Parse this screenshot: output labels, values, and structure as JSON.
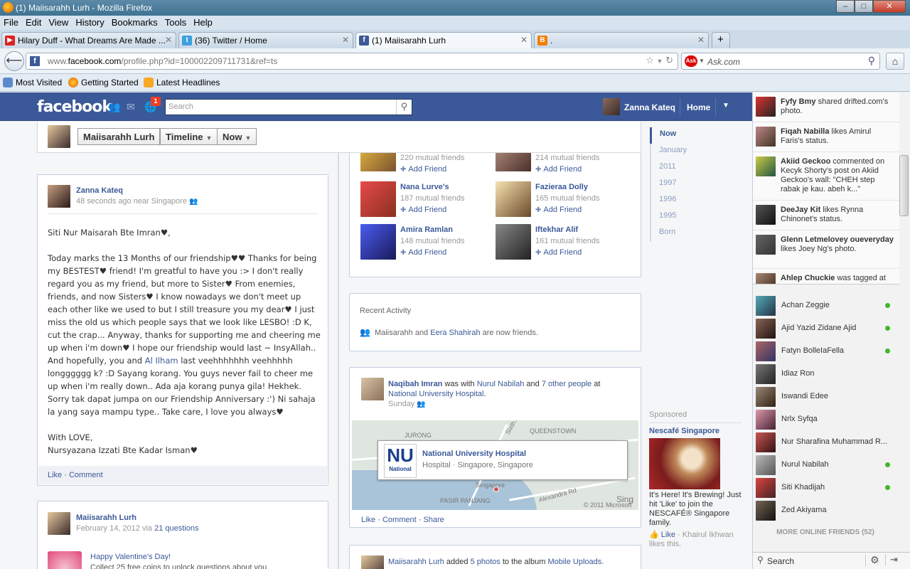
{
  "window": {
    "title": "(1) Maiisarahh Lurh - Mozilla Firefox",
    "min": "‒",
    "max": "□",
    "close": "✕"
  },
  "menu": [
    "File",
    "Edit",
    "View",
    "History",
    "Bookmarks",
    "Tools",
    "Help"
  ],
  "tabs": [
    {
      "label": "Hilary Duff - What Dreams Are Made ...",
      "icon": "youtube-icon",
      "color": "#d22"
    },
    {
      "label": "(36) Twitter / Home",
      "icon": "twitter-icon",
      "color": "#3aa0e0"
    },
    {
      "label": "(1) Maiisarahh Lurh",
      "icon": "facebook-icon",
      "color": "#3b5998"
    },
    {
      "label": ".",
      "icon": "blogger-icon",
      "color": "#f57d00"
    }
  ],
  "new_tab": "+",
  "url": {
    "prefix": "www.",
    "domain": "facebook.com",
    "rest": "/profile.php?id=100002209711731&ref=ts"
  },
  "search_engine": {
    "badge": "Ask",
    "placeholder": "Ask.com"
  },
  "bookmarks": [
    "Most Visited",
    "Getting Started",
    "Latest Headlines"
  ],
  "fb": {
    "logo": "facebook",
    "notif_count": "1",
    "search_placeholder": "Search",
    "user_name": "Zanna Kateq",
    "home": "Home"
  },
  "profile_bar": {
    "name": "Maiisarahh Lurh",
    "timeline": "Timeline",
    "now": "Now"
  },
  "post1": {
    "author": "Zanna Kateq",
    "meta": "48 seconds ago near Singapore",
    "body": "Siti Nur Maisarah Bte Imran♥,\n\nToday marks the 13 Months of our friendship♥♥ Thanks for being my BESTEST♥ friend! I'm greatful to have you :> I don't really regard you as my friend, but more to Sister♥ From enemies, friends, and now Sisters♥ I know nowadays we don't meet up each other like we used to but I still treasure you my dear♥ I just miss the old us which people says that we look like LESBO! :D K, cut the crap... Anyway, thanks for supporting me and cheering me up when i'm down♥ I hope our friendship would last ~ InsyAllah.. And hopefully, you and ",
    "mention": "Al Ilham",
    "body2": " last veehhhhhhh veehhhhh longggggg k? :D Sayang korang. You guys never fail to cheer me up when i'm really down.. Ada aja korang punya gila! Hekhek. Sorry tak dapat jumpa on our Friendship Anniversary :') Ni sahaja la yang saya mampu type.. Take care, I love you always♥\n\nWith LOVE,\nNursyazana Izzati Bte Kadar Isman♥",
    "like": "Like",
    "comment": "Comment"
  },
  "post2": {
    "author": "Maiisarahh Lurh",
    "meta_date": "February 14, 2012 via ",
    "meta_app": "21 questions",
    "app_title": "Happy Valentine's Day!",
    "app_desc": "Collect 25 free coins to unlock questions about you."
  },
  "friends": [
    {
      "name": "",
      "mutual": "220 mutual friends",
      "add": "Add Friend"
    },
    {
      "name": "",
      "mutual": "214 mutual friends",
      "add": "Add Friend"
    },
    {
      "name": "Nana Lurve's",
      "mutual": "187 mutual friends",
      "add": "Add Friend"
    },
    {
      "name": "Fazieraa Dolly",
      "mutual": "165 mutual friends",
      "add": "Add Friend"
    },
    {
      "name": "Amira Ramlan",
      "mutual": "148 mutual friends",
      "add": "Add Friend"
    },
    {
      "name": "Iftekhar Alif",
      "mutual": "161 mutual friends",
      "add": "Add Friend"
    }
  ],
  "activity": {
    "heading": "Recent Activity",
    "a": "Maiisarahh",
    "and": " and ",
    "b": "Eera Shahirah",
    "tail": " are now friends."
  },
  "checkin": {
    "author": "Naqibah Imran",
    "with": " was with ",
    "friend": "Nurul Nabilah",
    "and": " and ",
    "others": "7 other people",
    "at": " at ",
    "place": "National University Hospital",
    "dot": ".",
    "when": "Sunday",
    "map_labels": [
      "JURONG",
      "QUEENSTOWN",
      "Singapore",
      "PASIR PANJANG",
      "Alexandra Rd",
      "Sixth Av",
      "© 2011 Microsoft",
      "Sing"
    ],
    "pop_name": "National University Hospital",
    "pop_desc": "Hospital · Singapore, Singapore",
    "pop_logo": "NU",
    "pop_logo_sub": "National",
    "actions": [
      "Like",
      "Comment",
      "Share"
    ]
  },
  "album": {
    "author": "Maiisarahh Lurh",
    "added": " added ",
    "photos": "5 photos",
    "to": " to the album ",
    "album": "Mobile Uploads",
    "dot": "."
  },
  "years": [
    "Now",
    "January",
    "2011",
    "1997",
    "1996",
    "1995",
    "Born"
  ],
  "sponsored": {
    "label": "Sponsored",
    "title": "Nescafé Singapore",
    "body": "It's Here! It's Brewing! Just hit 'Like' to join the NESCAFÉ® Singapore family.",
    "like": "Like",
    "like_by": "Khairul Ikhwan likes this."
  },
  "ticker": [
    {
      "who": "Fyfy Bmy",
      "what": " shared drifted.com's photo."
    },
    {
      "who": "Fiqah Nabilla",
      "what": " likes Amirul Faris's status."
    },
    {
      "who": "Akiid Geckoo",
      "what": " commented on Kecyk Shorty's post on Akiid Geckoo's wall: \"CHEH step rabak je kau. abeh k...\""
    },
    {
      "who": "DeeJay Kit",
      "what": " likes Rynna Chinonet's status."
    },
    {
      "who": "Glenn Letmelovey oueveryday",
      "what": " likes Joey Ng's photo."
    },
    {
      "who": "Ahlep Chuckie",
      "what": " was tagged at"
    }
  ],
  "chat": [
    {
      "name": "Achan Zeggie",
      "online": true
    },
    {
      "name": "Ajid Yazid Zidane Ajid",
      "online": true
    },
    {
      "name": "Fatyn BolleIaFella",
      "online": true
    },
    {
      "name": "Idiaz Ron",
      "online": false
    },
    {
      "name": "Iswandi Edee",
      "online": false
    },
    {
      "name": "Nrlx Syfqa",
      "online": false
    },
    {
      "name": "Nur Sharafina Muhammad R...",
      "online": false
    },
    {
      "name": "Nurul Nabilah",
      "online": true
    },
    {
      "name": "Siti Khadijah",
      "online": true
    },
    {
      "name": "Zed Akiyama",
      "online": false
    }
  ],
  "more_online": "MORE ONLINE FRIENDS (52)",
  "chat_search": "Search"
}
